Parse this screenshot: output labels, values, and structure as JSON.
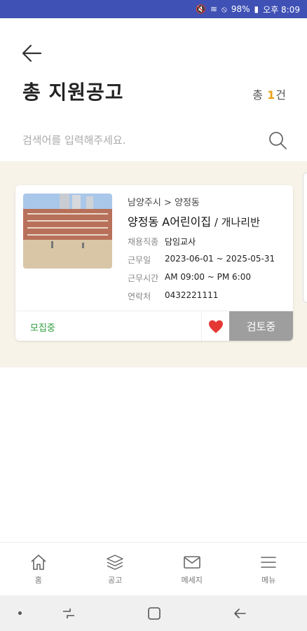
{
  "status_bar": {
    "battery": "98%",
    "time": "오후 8:09"
  },
  "header": {
    "title": "총 지원공고",
    "total_prefix": "총",
    "total_count": "1",
    "total_suffix": "건"
  },
  "search": {
    "placeholder": "검색어를 입력해주세요.",
    "value": ""
  },
  "listing": {
    "region": "남양주시 > 양정동",
    "center_name": "양정동 A어린이집",
    "class_name": " / 개나리반",
    "rows": [
      {
        "label": "채용직종",
        "value": "담임교사"
      },
      {
        "label": "근무일",
        "value": "2023-06-01 ~ 2025-05-31"
      },
      {
        "label": "근무시간",
        "value": "AM 09:00 ~ PM 6:00"
      },
      {
        "label": "연락처",
        "value": "0432221111"
      }
    ],
    "status": "모집중",
    "favorited": true,
    "review_label": "검토중"
  },
  "bottom_nav": [
    {
      "label": "홈",
      "icon": "home-icon"
    },
    {
      "label": "공고",
      "icon": "layers-icon"
    },
    {
      "label": "메세지",
      "icon": "mail-icon"
    },
    {
      "label": "메뉴",
      "icon": "menu-icon"
    }
  ],
  "colors": {
    "status_bar": "#3f51b5",
    "list_bg": "#f7f3e8",
    "accent_count": "#e8a317",
    "status_green": "#2e9e3e",
    "heart": "#e53935",
    "review_btn": "#9e9e9e"
  }
}
